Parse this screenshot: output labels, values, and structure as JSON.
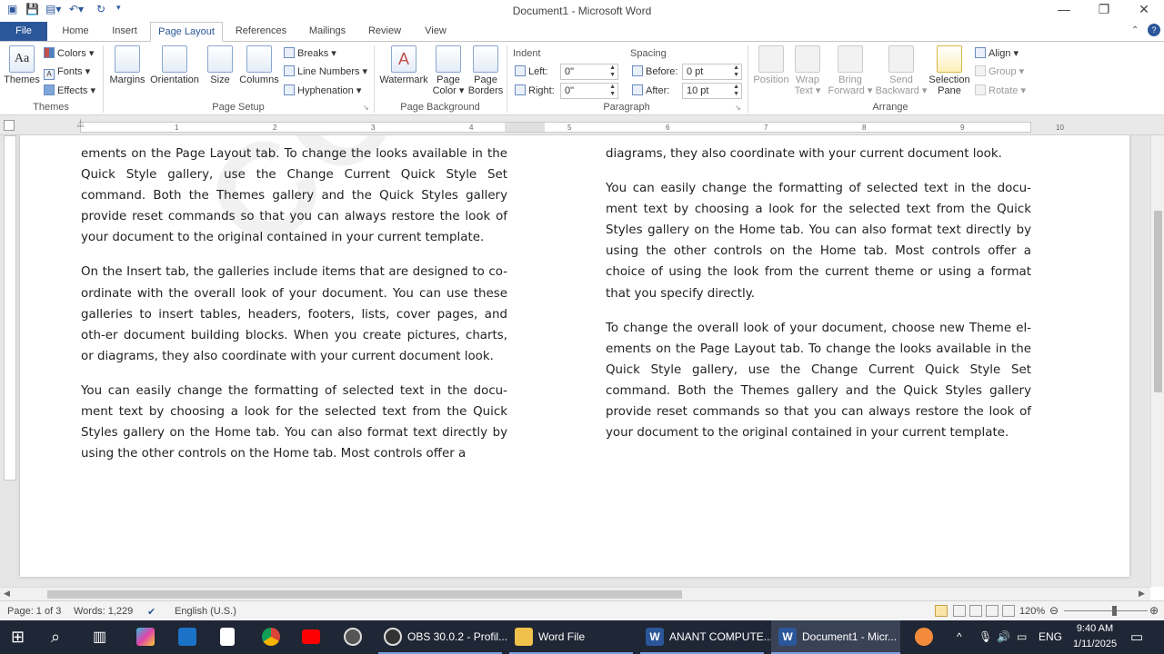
{
  "window": {
    "title": "Document1 - Microsoft Word",
    "minimize": "—",
    "restore": "❐",
    "close": "✕"
  },
  "tabs": [
    "File",
    "Home",
    "Insert",
    "Page Layout",
    "References",
    "Mailings",
    "Review",
    "View"
  ],
  "ribbon": {
    "themes": {
      "themes": "Themes",
      "colors": "Colors",
      "fonts": "Fonts",
      "effects": "Effects",
      "group": "Themes"
    },
    "page_setup": {
      "margins": "Margins",
      "orientation": "Orientation",
      "size": "Size",
      "columns": "Columns",
      "breaks": "Breaks",
      "line_numbers": "Line Numbers",
      "hyphenation": "Hyphenation",
      "group": "Page Setup"
    },
    "page_background": {
      "watermark": "Watermark",
      "page_color_1": "Page",
      "page_color_2": "Color",
      "page_borders_1": "Page",
      "page_borders_2": "Borders",
      "group": "Page Background"
    },
    "paragraph": {
      "indent": "Indent",
      "spacing": "Spacing",
      "left_label": "Left:",
      "left_value": "0\"",
      "right_label": "Right:",
      "right_value": "0\"",
      "before_label": "Before:",
      "before_value": "0 pt",
      "after_label": "After:",
      "after_value": "10 pt",
      "group": "Paragraph"
    },
    "arrange": {
      "position": "Position",
      "wrap_1": "Wrap",
      "wrap_2": "Text",
      "bring_1": "Bring",
      "bring_2": "Forward",
      "send_1": "Send",
      "send_2": "Backward",
      "sel_1": "Selection",
      "sel_2": "Pane",
      "align": "Align",
      "group_btn": "Group",
      "rotate": "Rotate",
      "group": "Arrange"
    }
  },
  "ruler": [
    "1",
    "2",
    "3",
    "4",
    "5",
    "6",
    "7",
    "8",
    "9",
    "10"
  ],
  "document": {
    "watermark": "CONFIDENTIAL",
    "left_column": [
      "ements on the Page Layout tab. To change the looks available in the Quick Style gallery, use the Change Current Quick Style Set command. Both the Themes gallery and the Quick Styles gallery provide reset commands so that you can always restore the look of your document to the original contained in your current template.",
      "On the Insert tab, the galleries include items that are designed to co-ordinate with the overall look of your document. You can use these galleries to insert tables, headers, footers, lists, cover pages, and oth-er document building blocks. When you create pictures, charts, or diagrams, they also coordinate with your current document look.",
      "You can easily change the formatting of selected text in the docu-ment text by choosing a look for the selected text from the Quick Styles gallery on the Home tab. You can also format text directly by using the other controls on the Home tab. Most controls offer a"
    ],
    "right_column": [
      "diagrams, they also coordinate with your current document look.",
      "You can easily change the formatting of selected text in the docu-ment text by choosing a look for the selected text from the Quick Styles gallery on the Home tab. You can also format text directly by using the other controls on the Home tab. Most controls offer a choice of using the look from the current theme or using a format that you specify directly.",
      "To change the overall look of your document, choose new Theme el-ements on the Page Layout tab. To change the looks available in the Quick Style gallery, use the Change Current Quick Style Set command. Both the Themes gallery and the Quick Styles gallery provide reset commands so that you can always restore the look of your document to the original contained in your current template."
    ]
  },
  "status": {
    "page": "Page: 1 of 3",
    "words": "Words: 1,229",
    "language": "English (U.S.)",
    "zoom": "120%",
    "zoom_fraction": 0.6
  },
  "taskbar": {
    "obs": "OBS 30.0.2 - Profil...",
    "word_file": "Word File",
    "anant": "ANANT COMPUTE...",
    "document": "Document1 - Micr...",
    "lang": "ENG",
    "time": "9:40 AM",
    "date": "1/11/2025"
  },
  "colors": {
    "accent": "#2b579a",
    "taskbar": "#1f2635"
  }
}
